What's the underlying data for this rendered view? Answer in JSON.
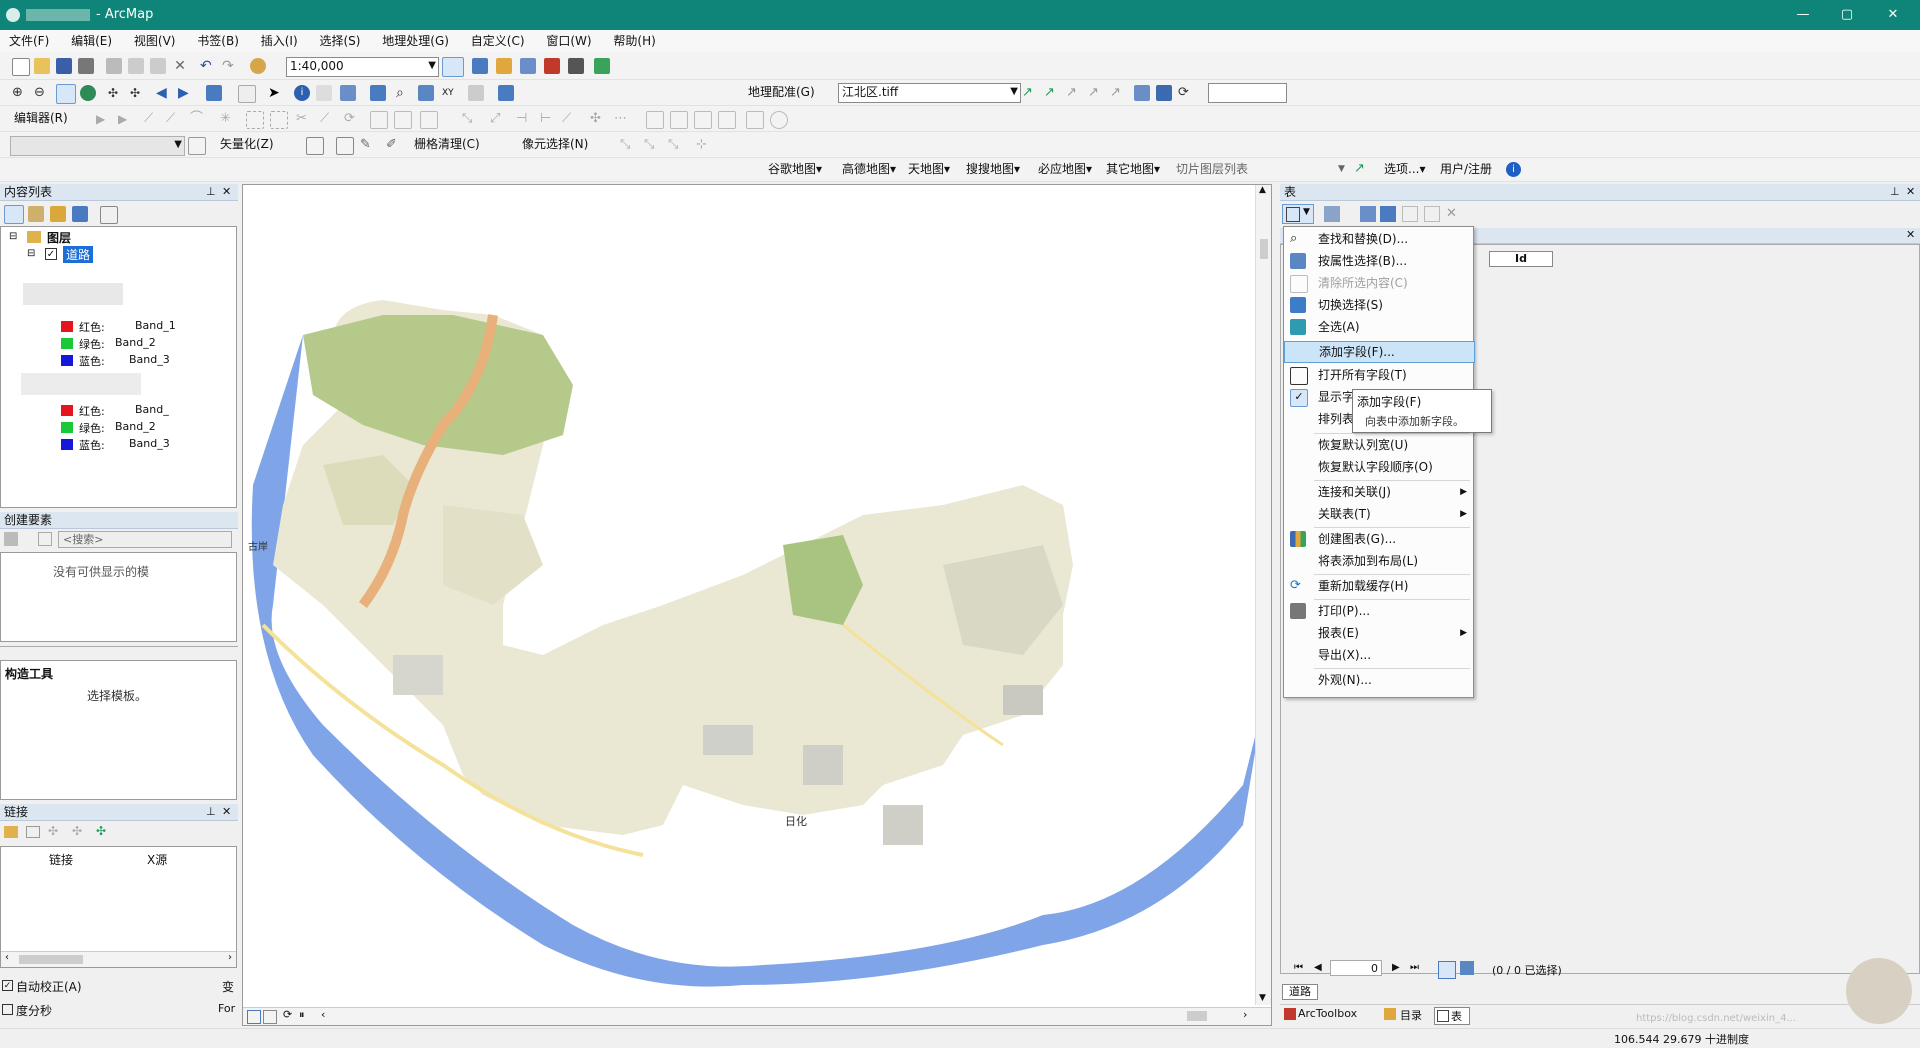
{
  "window": {
    "title": "- ArcMap",
    "minimize": "—",
    "maximize": "▢",
    "close": "✕"
  },
  "menubar": [
    "文件(F)",
    "编辑(E)",
    "视图(V)",
    "书签(B)",
    "插入(I)",
    "选择(S)",
    "地理处理(G)",
    "自定义(C)",
    "窗口(W)",
    "帮助(H)"
  ],
  "toolbar1": {
    "scale": "1:40,000"
  },
  "toolbar2": {
    "georef_label": "地理配准(G)",
    "layer_combo": "江北区.tiff",
    "blank_combo": ""
  },
  "toolbar3": {
    "editor_label": "编辑器(R)"
  },
  "toolbar4": {
    "vectorize_label": "矢量化(Z)",
    "raster_clean_label": "栅格清理(C)",
    "cell_select_label": "像元选择(N)"
  },
  "toolbar5": {
    "items": [
      "谷歌地图",
      "高德地图",
      "天地图",
      "搜搜地图",
      "必应地图",
      "其它地图"
    ],
    "tile_list": "切片图层列表",
    "options": "选项...",
    "user": "用户/注册",
    "info": "i"
  },
  "toc": {
    "title": "内容列表",
    "pin": "📌",
    "close": "✕",
    "root_label": "图层",
    "layer_label": "道路",
    "group1": [
      {
        "label": "红色:",
        "band": "Band_1",
        "color": "#e8141c"
      },
      {
        "label": "绿色:",
        "band": "Band_2",
        "color": "#19c93a"
      },
      {
        "label": "蓝色:",
        "band": "Band_3",
        "color": "#1418d8"
      }
    ],
    "group2": [
      {
        "label": "红色:",
        "band": "Band_",
        "color": "#e8141c"
      },
      {
        "label": "绿色:",
        "band": "Band_2",
        "color": "#19c93a"
      },
      {
        "label": "蓝色:",
        "band": "Band_3",
        "color": "#1418d8"
      }
    ]
  },
  "create_features": {
    "title": "创建要素",
    "search_placeholder": "<搜索>",
    "empty_msg": "没有可供显示的模"
  },
  "construct_tools": {
    "title": "构造工具",
    "msg": "选择模板。"
  },
  "links": {
    "title": "链接",
    "col_link": "链接",
    "col_x": "X源"
  },
  "status_left": {
    "auto_adjust": "自动校正(A)",
    "dms": "度分秒",
    "right1": "变",
    "right2": "For"
  },
  "table_window": {
    "title": "表",
    "column": "Id",
    "nav": {
      "first": "⏮",
      "prev": "◀",
      "record": "0",
      "next": "▶",
      "last": "⏭"
    },
    "selection_info": "(0 / 0 已选择)",
    "tab_label": "道路",
    "bottom_tabs": [
      "ArcToolbox",
      "目录",
      "表"
    ]
  },
  "context_menu": {
    "items": [
      {
        "label": "查找和替换(D)...",
        "icon": "binoculars-icon"
      },
      {
        "label": "按属性选择(B)...",
        "icon": "select-by-attr-icon"
      },
      {
        "label": "清除所选内容(C)",
        "icon": "clear-select-icon",
        "disabled": true
      },
      {
        "label": "切换选择(S)",
        "icon": "switch-select-icon"
      },
      {
        "label": "全选(A)",
        "icon": "select-all-icon"
      },
      {
        "label": "添加字段(F)...",
        "highlight": true
      },
      {
        "label": "打开所有字段(T)",
        "icon": "open-fields-icon"
      },
      {
        "label": "显示字段别名(W)",
        "icon": "check-icon"
      },
      {
        "label": "排列表(R)",
        "submenu": true
      },
      {
        "label": "恢复默认列宽(U)"
      },
      {
        "label": "恢复默认字段顺序(O)"
      },
      {
        "label": "连接和关联(J)",
        "submenu": true
      },
      {
        "label": "关联表(T)",
        "submenu": true
      },
      {
        "label": "创建图表(G)...",
        "icon": "chart-icon"
      },
      {
        "label": "将表添加到布局(L)"
      },
      {
        "label": "重新加载缓存(H)",
        "icon": "refresh-icon"
      },
      {
        "label": "打印(P)...",
        "icon": "print-icon"
      },
      {
        "label": "报表(E)",
        "submenu": true
      },
      {
        "label": "导出(X)..."
      },
      {
        "label": "外观(N)..."
      }
    ],
    "tooltip_title": "添加字段(F)",
    "tooltip_desc": "向表中添加新字段。"
  },
  "map_labels": [
    "日化",
    "古岸"
  ],
  "status_bar": {
    "coords": "106.544  29.679 十进制度"
  },
  "watermark": "https://blog.csdn.net/weixin_4..."
}
